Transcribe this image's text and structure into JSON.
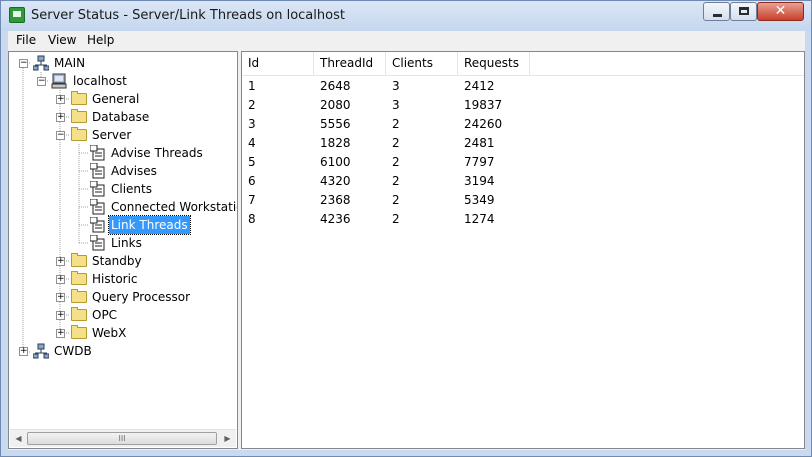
{
  "window": {
    "title": "Server Status - Server/Link Threads on localhost"
  },
  "menu": {
    "file": "File",
    "view": "View",
    "help": "Help"
  },
  "tree": {
    "main": "MAIN",
    "localhost": "localhost",
    "general": "General",
    "database": "Database",
    "server": "Server",
    "advise_threads": "Advise Threads",
    "advises": "Advises",
    "clients": "Clients",
    "connected_workstations": "Connected Workstatio",
    "link_threads": "Link Threads",
    "links": "Links",
    "standby": "Standby",
    "historic": "Historic",
    "query_processor": "Query Processor",
    "opc": "OPC",
    "webx": "WebX",
    "cwdb": "CWDB"
  },
  "table": {
    "columns": [
      "Id",
      "ThreadId",
      "Clients",
      "Requests"
    ],
    "rows": [
      [
        "1",
        "2648",
        "3",
        "2412"
      ],
      [
        "2",
        "2080",
        "3",
        "19837"
      ],
      [
        "3",
        "5556",
        "2",
        "24260"
      ],
      [
        "4",
        "1828",
        "2",
        "2481"
      ],
      [
        "5",
        "6100",
        "2",
        "7797"
      ],
      [
        "6",
        "4320",
        "2",
        "3194"
      ],
      [
        "7",
        "2368",
        "2",
        "5349"
      ],
      [
        "8",
        "4236",
        "2",
        "1274"
      ]
    ]
  },
  "scrollbar": {
    "thumb_grip": "III"
  }
}
